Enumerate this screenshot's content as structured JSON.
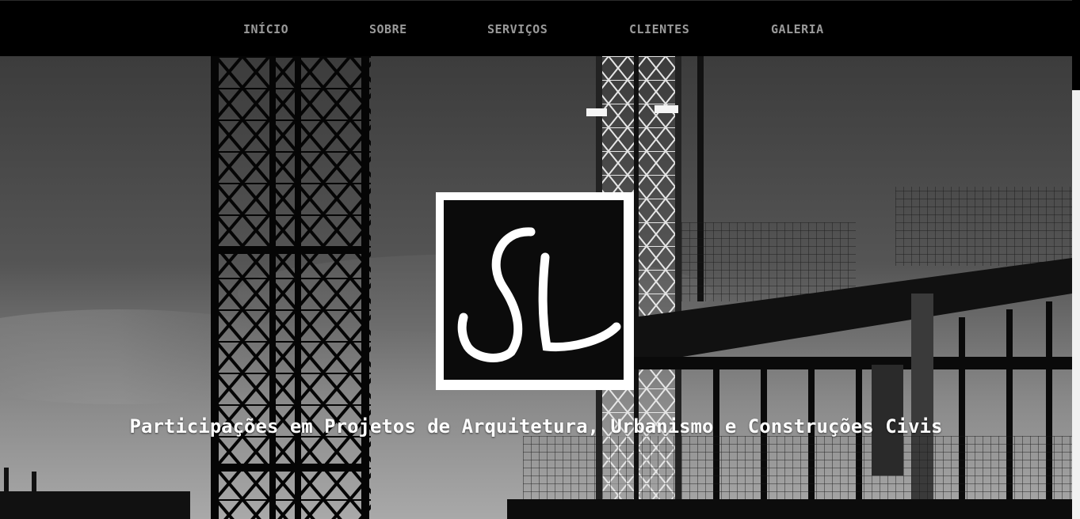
{
  "nav": {
    "items": [
      {
        "label": "INÍCIO"
      },
      {
        "label": "SOBRE"
      },
      {
        "label": "SERVIÇOS"
      },
      {
        "label": "CLIENTES"
      },
      {
        "label": "GALERIA"
      }
    ]
  },
  "hero": {
    "logo_text": "SL",
    "tagline": "Participações em Projetos de Arquitetura, Urbanismo e Construções Civis"
  },
  "colors": {
    "navbar_bg": "#000000",
    "nav_text": "#9a9a9a",
    "tagline_text": "#ffffff",
    "logo_bg": "#0b0b0b",
    "logo_border": "#ffffff"
  }
}
